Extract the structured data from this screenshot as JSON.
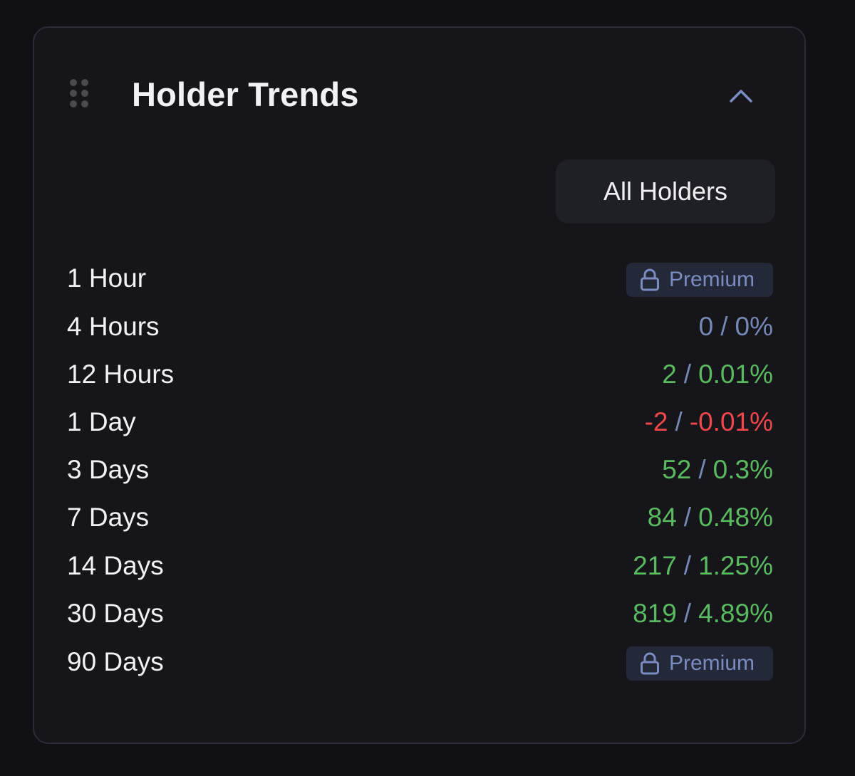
{
  "panel": {
    "title": "Holder Trends",
    "filter_label": "All Holders",
    "premium_label": "Premium"
  },
  "colors": {
    "positive": "#5aba5f",
    "negative": "#f0474b",
    "neutral": "#7688b5",
    "accent": "#7b8cc0"
  },
  "icons": {
    "drag": "drag-handle-icon",
    "collapse": "chevron-up-icon",
    "lock": "lock-icon"
  },
  "rows": [
    {
      "label": "1 Hour",
      "locked": true
    },
    {
      "label": "4 Hours",
      "count": "0",
      "percent": "0%",
      "trend": "neutral"
    },
    {
      "label": "12 Hours",
      "count": "2",
      "percent": "0.01%",
      "trend": "positive"
    },
    {
      "label": "1 Day",
      "count": "-2",
      "percent": "-0.01%",
      "trend": "negative"
    },
    {
      "label": "3 Days",
      "count": "52",
      "percent": "0.3%",
      "trend": "positive"
    },
    {
      "label": "7 Days",
      "count": "84",
      "percent": "0.48%",
      "trend": "positive"
    },
    {
      "label": "14 Days",
      "count": "217",
      "percent": "1.25%",
      "trend": "positive"
    },
    {
      "label": "30 Days",
      "count": "819",
      "percent": "4.89%",
      "trend": "positive"
    },
    {
      "label": "90 Days",
      "locked": true
    }
  ]
}
